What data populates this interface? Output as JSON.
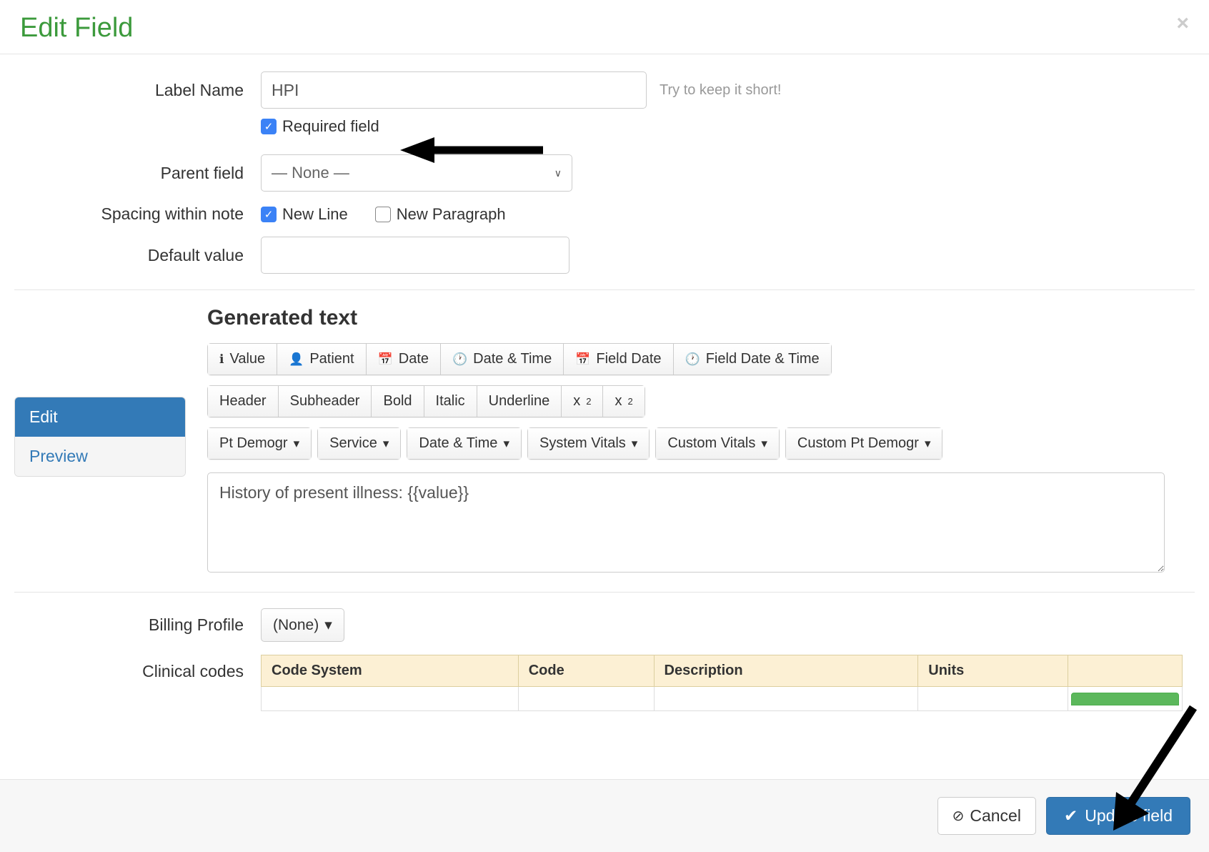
{
  "modal_title": "Edit Field",
  "labels": {
    "label_name": "Label Name",
    "parent_field": "Parent field",
    "spacing": "Spacing within note",
    "default_value": "Default value",
    "billing_profile": "Billing Profile",
    "clinical_codes": "Clinical codes"
  },
  "label_name": {
    "value": "HPI",
    "help": "Try to keep it short!"
  },
  "required_field": {
    "label": "Required field",
    "checked": true
  },
  "parent_field": {
    "value": "— None —"
  },
  "spacing_options": {
    "new_line": {
      "label": "New Line",
      "checked": true
    },
    "new_paragraph": {
      "label": "New Paragraph",
      "checked": false
    }
  },
  "default_value": {
    "value": ""
  },
  "generated_text": {
    "heading": "Generated text",
    "content": "History of present illness: {{value}}"
  },
  "side_tabs": {
    "edit": "Edit",
    "preview": "Preview"
  },
  "toolbar": {
    "row1": {
      "value": "Value",
      "patient": "Patient",
      "date": "Date",
      "datetime": "Date & Time",
      "field_date": "Field Date",
      "field_datetime": "Field Date & Time"
    },
    "row2": {
      "header": "Header",
      "subheader": "Subheader",
      "bold": "Bold",
      "italic": "Italic",
      "underline": "Underline",
      "sub": "x",
      "sup": "x"
    },
    "row3": {
      "pt_demogr": "Pt Demogr",
      "service": "Service",
      "date_time": "Date & Time",
      "system_vitals": "System Vitals",
      "custom_vitals": "Custom Vitals",
      "custom_pt_demogr": "Custom Pt Demogr"
    }
  },
  "billing_profile": {
    "value": "(None)"
  },
  "codes_table": {
    "cols": {
      "code_system": "Code System",
      "code": "Code",
      "description": "Description",
      "units": "Units"
    }
  },
  "footer": {
    "cancel": "Cancel",
    "update": "Update field"
  }
}
